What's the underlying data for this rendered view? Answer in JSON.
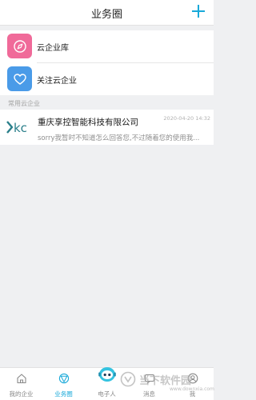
{
  "header": {
    "title": "业务圈",
    "add_icon": "plus-icon",
    "accent": "#19a9d9"
  },
  "entries": [
    {
      "label": "云企业库",
      "icon": "compass-icon",
      "color": "#f06a99"
    },
    {
      "label": "关注云企业",
      "icon": "heart-icon",
      "color": "#4a9be8"
    }
  ],
  "section": {
    "label": "常用云企业"
  },
  "companies": [
    {
      "logo_text": "kc",
      "name": "重庆享控智能科技有限公司",
      "time": "2020-04-20 14:32",
      "preview": "sorry我暂时不知道怎么回答您,不过随着您的使用我..."
    }
  ],
  "tabbar": {
    "active_color": "#19a9d9",
    "tabs": [
      {
        "label": "我的企业",
        "icon": "home-icon",
        "active": false
      },
      {
        "label": "业务圈",
        "icon": "circle-network-icon",
        "active": true
      },
      {
        "label": "电子人",
        "icon": "robot-icon",
        "active": false
      },
      {
        "label": "消息",
        "icon": "message-icon",
        "active": false
      },
      {
        "label": "我",
        "icon": "user-icon",
        "active": false
      }
    ]
  },
  "watermark": {
    "name": "当下软件园",
    "url": "www.downxia.com"
  }
}
